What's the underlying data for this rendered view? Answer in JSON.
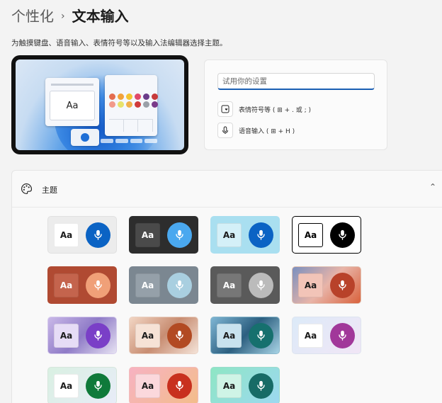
{
  "breadcrumb": {
    "parent": "个性化",
    "separator": "›",
    "current": "文本输入"
  },
  "description": "为触摸键盘、语音输入、表情符号等以及输入法编辑器选择主题。",
  "preview": {
    "key_label": "Aa"
  },
  "try_panel": {
    "input_placeholder": "试用你的设置",
    "shortcuts": [
      {
        "icon": "emoji-icon",
        "label": "表情符号等 ( ⊞ + . 或 ; )"
      },
      {
        "icon": "microphone-icon",
        "label": "语音输入 ( ⊞ + H )"
      }
    ]
  },
  "themes": {
    "title": "主题",
    "aa_label": "Aa",
    "tiles": [
      {
        "bg": "#ececec",
        "key": "#ffffff",
        "key_text": "#1a1a1a",
        "mic": "#0b63c4",
        "border": "#e0e0e0"
      },
      {
        "bg": "#2d2d2d",
        "key": "#4a4a4a",
        "key_text": "#ffffff",
        "mic": "#4aa8ef",
        "border": "#2d2d2d"
      },
      {
        "bg": "#a9dff0",
        "key": "#d4f0f8",
        "key_text": "#1a1a1a",
        "mic": "#0b63c4",
        "border": "#a9dff0"
      },
      {
        "bg": "#ffffff",
        "key": "#ffffff",
        "key_text": "#000000",
        "mic": "#000000",
        "border": "#000000",
        "selected": true
      },
      {
        "bg": "#b04a32",
        "key": "#c4644d",
        "key_text": "#ffffff",
        "mic": "#f0a078",
        "border": "#b04a32"
      },
      {
        "bg": "#7b8791",
        "key": "#95a0a9",
        "key_text": "#ffffff",
        "mic": "#a9cfe0",
        "border": "#7b8791"
      },
      {
        "bg": "#5a5a5a",
        "key": "#777777",
        "key_text": "#ffffff",
        "mic": "#bbbbbb",
        "border": "#5a5a5a"
      },
      {
        "bg": "linear-gradient(135deg,#7a8fbf,#e8b4a8,#d9623c)",
        "key": "#f2c4b8",
        "key_text": "#1a1a1a",
        "mic": "#b8422a",
        "border": "#e0c0b0"
      },
      {
        "bg": "linear-gradient(135deg,#c9b8e8,#8f7bc7,#e6e2f2)",
        "key": "#e6dcf6",
        "key_text": "#1a1a1a",
        "mic": "#7a3fc7",
        "border": "#d6ccec"
      },
      {
        "bg": "linear-gradient(135deg,#f2d6c4,#c88d72,#f4e3d8)",
        "key": "#f6e2d6",
        "key_text": "#1a1a1a",
        "mic": "#b24a22",
        "border": "#ead2c4"
      },
      {
        "bg": "linear-gradient(135deg,#7fb6d4,#2c5f80,#a8d4e6)",
        "key": "#c8e2ee",
        "key_text": "#1a1a1a",
        "mic": "#16706e",
        "border": "#8ab8cc"
      },
      {
        "bg": "linear-gradient(135deg,#dceaf8,#f1e6f6)",
        "key": "#ffffff",
        "key_text": "#1a1a1a",
        "mic": "#a1389a",
        "border": "#dde4ef"
      },
      {
        "bg": "linear-gradient(135deg,#d9f0e2,#e8ecf8)",
        "key": "#ffffff",
        "key_text": "#1a1a1a",
        "mic": "#0f7a3a",
        "border": "#d6e6dc"
      },
      {
        "bg": "linear-gradient(135deg,#f7b2c2,#f3bd8a)",
        "key": "#fbd8dc",
        "key_text": "#1a1a1a",
        "mic": "#c8301e",
        "border": "#f2bcbc"
      },
      {
        "bg": "linear-gradient(135deg,#8ee6c4,#9cd8f0)",
        "key": "#cff4e6",
        "key_text": "#1a1a1a",
        "mic": "#176b66",
        "border": "#9adccc"
      }
    ]
  }
}
